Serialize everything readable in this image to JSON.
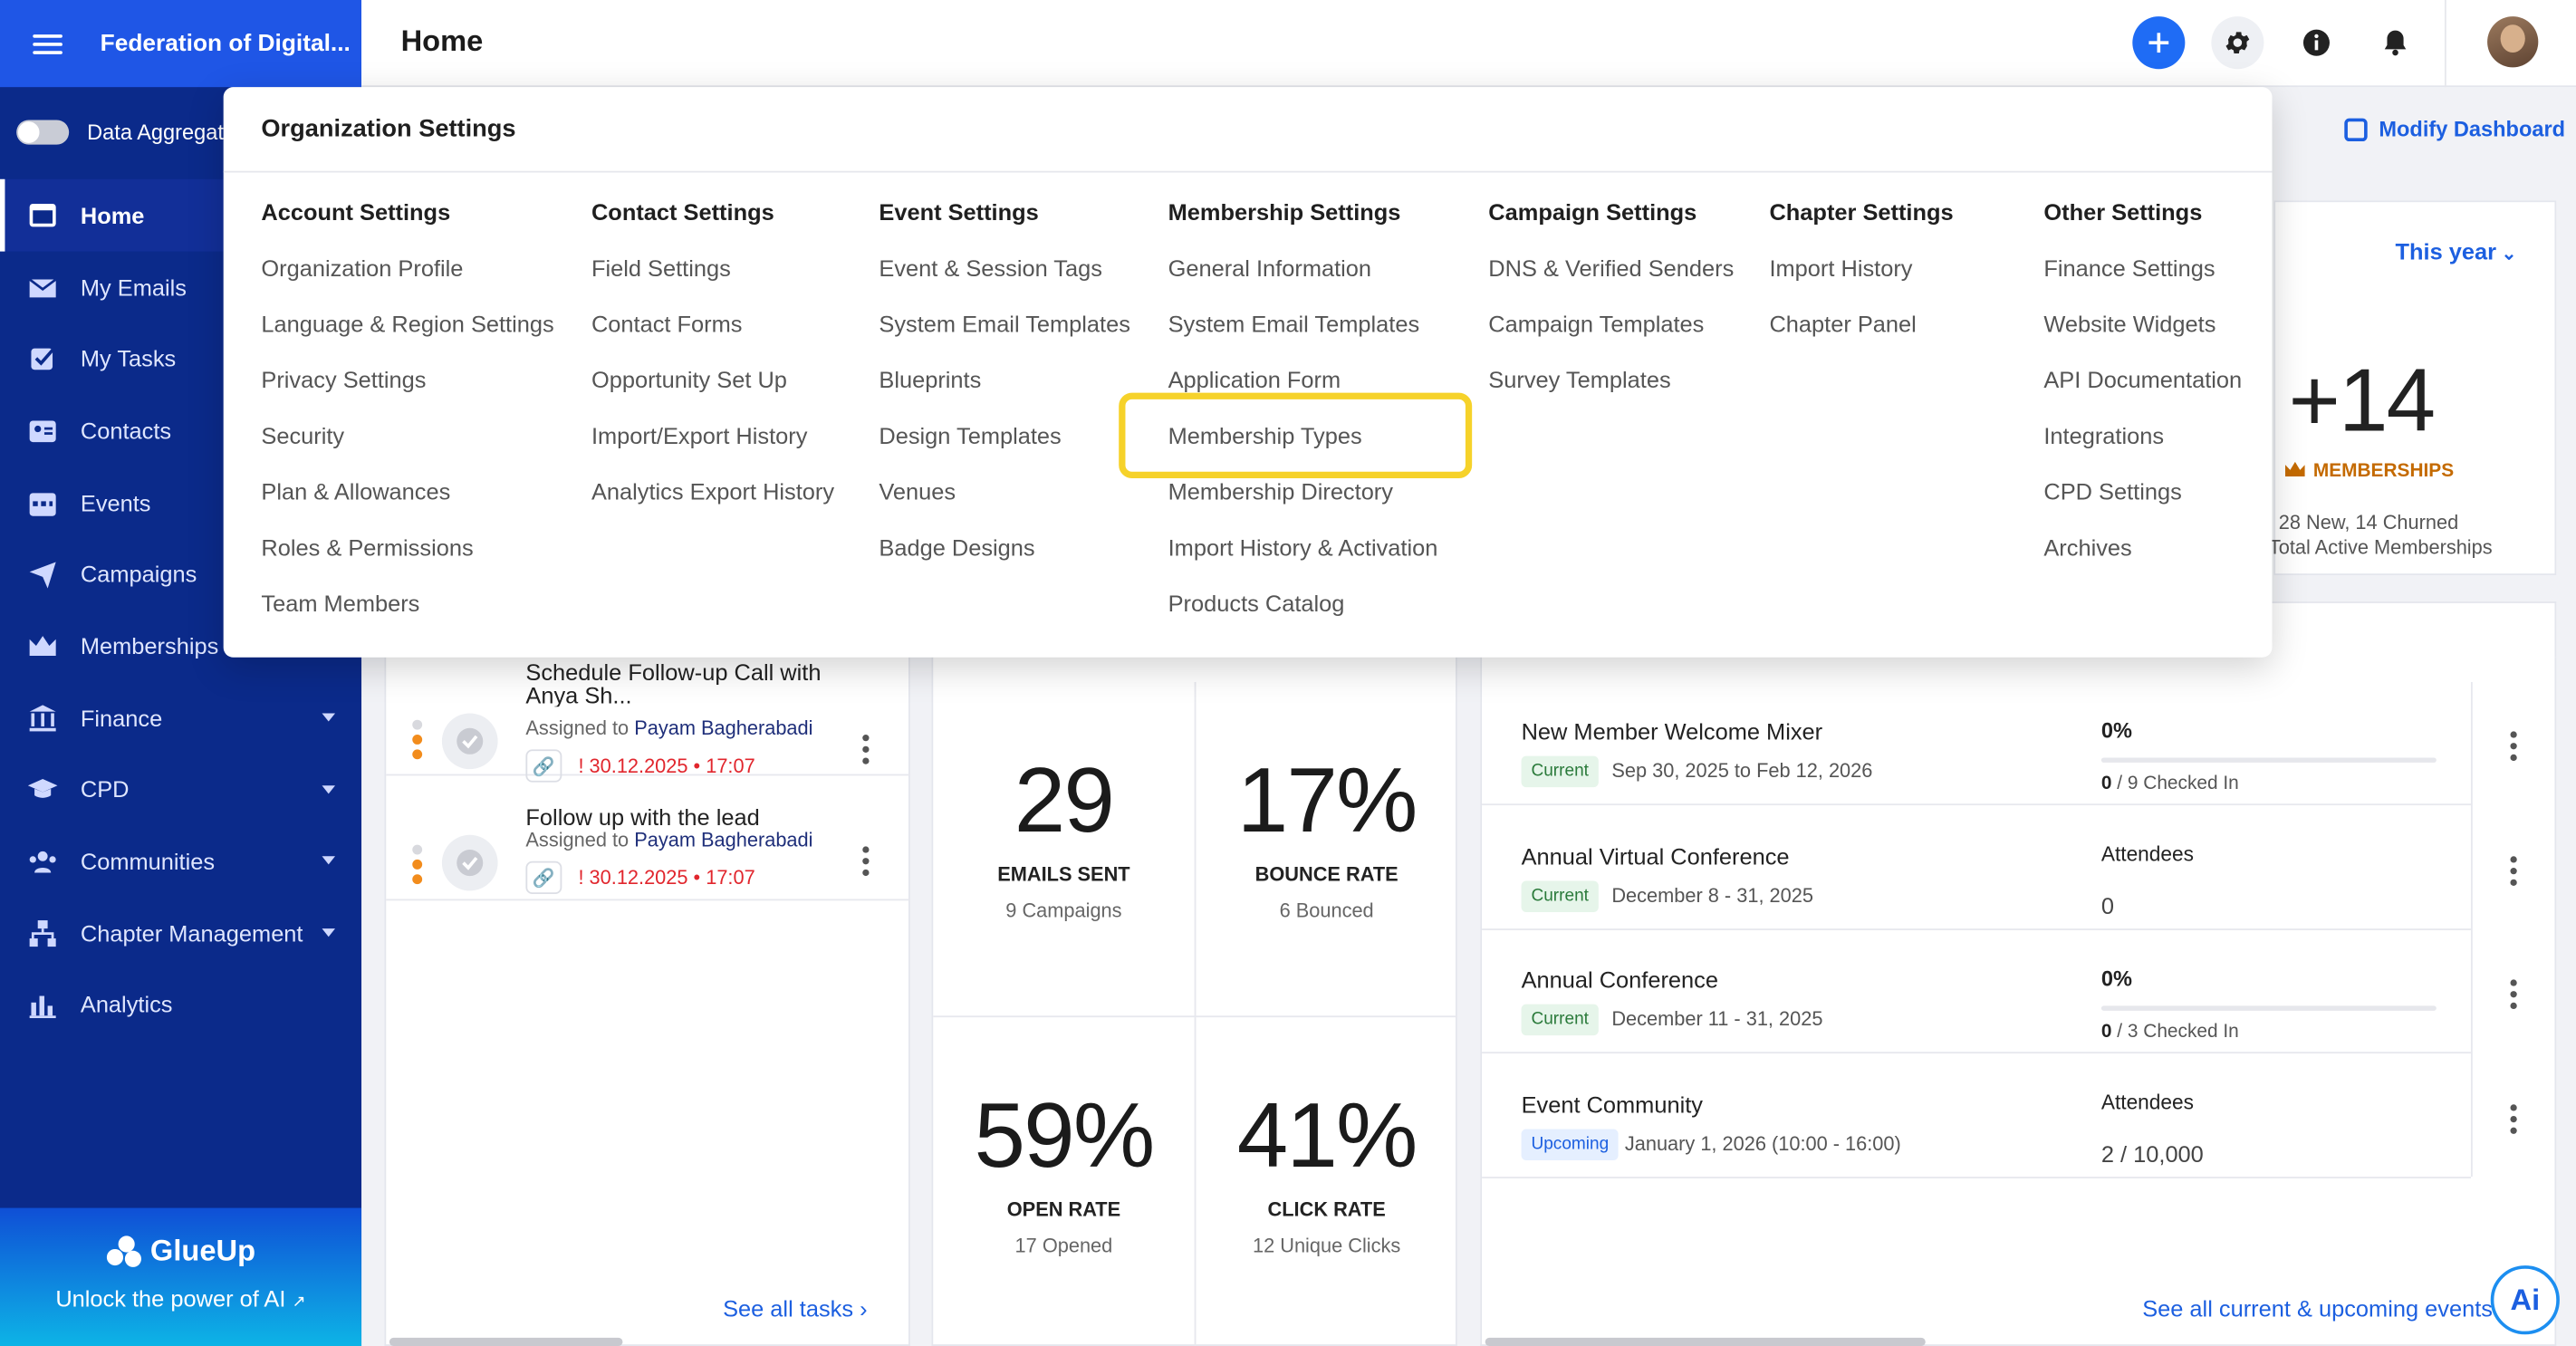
{
  "sidebar": {
    "org_name": "Federation of Digital...",
    "toggle_label": "Data Aggregat",
    "items": [
      {
        "label": "Home",
        "icon": "home-icon",
        "active": true
      },
      {
        "label": "My Emails",
        "icon": "mail-icon"
      },
      {
        "label": "My Tasks",
        "icon": "tasks-icon"
      },
      {
        "label": "Contacts",
        "icon": "contacts-icon"
      },
      {
        "label": "Events",
        "icon": "calendar-icon"
      },
      {
        "label": "Campaigns",
        "icon": "paper-plane-icon"
      },
      {
        "label": "Memberships",
        "icon": "crown-icon"
      },
      {
        "label": "Finance",
        "icon": "bank-icon",
        "caret": true
      },
      {
        "label": "CPD",
        "icon": "graduation-cap-icon",
        "caret": true
      },
      {
        "label": "Communities",
        "icon": "community-icon",
        "caret": true
      },
      {
        "label": "Chapter Management",
        "icon": "org-chart-icon",
        "caret": true
      },
      {
        "label": "Analytics",
        "icon": "bar-chart-icon"
      }
    ],
    "footer": {
      "brand": "GlueUp",
      "tagline": "Unlock the power of AI"
    }
  },
  "header": {
    "title": "Home"
  },
  "dashboard": {
    "modify_label": "Modify Dashboard",
    "memberships": {
      "period": "This year",
      "delta": "+14",
      "label": "MEMBERSHIPS",
      "new_churned": "28 New, 14 Churned",
      "total_label": "Total Active Memberships"
    },
    "tasks": {
      "items": [
        {
          "title": "Schedule Follow-up Call with Anya Sh...",
          "assigned_prefix": "Assigned to",
          "assignee": "Payam Bagherabadi",
          "due": "30.12.2025 • 17:07"
        },
        {
          "title": "Follow up with the lead",
          "assigned_prefix": "Assigned to",
          "assignee": "Payam Bagherabadi",
          "due": "30.12.2025 • 17:07"
        }
      ],
      "see_all": "See all tasks"
    },
    "stats": [
      {
        "value": "29",
        "label": "EMAILS SENT",
        "sub": "9 Campaigns"
      },
      {
        "value": "17%",
        "label": "BOUNCE RATE",
        "sub": "6 Bounced"
      },
      {
        "value": "59%",
        "label": "OPEN RATE",
        "sub": "17 Opened"
      },
      {
        "value": "41%",
        "label": "CLICK RATE",
        "sub": "12 Unique Clicks"
      }
    ],
    "events": {
      "items": [
        {
          "title": "New Member Welcome Mixer",
          "status": "Current",
          "date": "Sep 30, 2025 to Feb 12, 2026",
          "stat": "0%",
          "progress": 0,
          "checked": "0",
          "checked_rest": "/ 9 Checked In"
        },
        {
          "title": "Annual Virtual Conference",
          "status": "Current",
          "date": "December 8 - 31, 2025",
          "stat_label": "Attendees",
          "stat_value": "0"
        },
        {
          "title": "Annual Conference",
          "status": "Current",
          "date": "December 11 - 31, 2025",
          "stat": "0%",
          "progress": 0,
          "checked": "0",
          "checked_rest": "/ 3 Checked In"
        },
        {
          "title": "Event Community",
          "status": "Upcoming",
          "date": "January 1, 2026 (10:00 - 16:00)",
          "stat_label": "Attendees",
          "stat_value": "2 / 10,000"
        }
      ],
      "see_all": "See all current & upcoming events"
    },
    "ai_button": "Ai"
  },
  "settings_menu": {
    "title": "Organization Settings",
    "columns": [
      {
        "title": "Account Settings",
        "items": [
          "Organization Profile",
          "Language & Region Settings",
          "Privacy Settings",
          "Security",
          "Plan & Allowances",
          "Roles & Permissions",
          "Team Members"
        ]
      },
      {
        "title": "Contact Settings",
        "items": [
          "Field Settings",
          "Contact Forms",
          "Opportunity Set Up",
          "Import/Export History",
          "Analytics Export History"
        ]
      },
      {
        "title": "Event Settings",
        "items": [
          "Event & Session Tags",
          "System Email Templates",
          "Blueprints",
          "Design Templates",
          "Venues",
          "Badge Designs"
        ]
      },
      {
        "title": "Membership Settings",
        "items": [
          "General Information",
          "System Email Templates",
          "Application Form",
          "Membership Types",
          "Membership Directory",
          "Import History & Activation",
          "Products Catalog"
        ]
      },
      {
        "title": "Campaign Settings",
        "items": [
          "DNS & Verified Senders",
          "Campaign Templates",
          "Survey Templates"
        ]
      },
      {
        "title": "Chapter Settings",
        "items": [
          "Import History",
          "Chapter Panel"
        ]
      },
      {
        "title": "Other Settings",
        "items": [
          "Finance Settings",
          "Website Widgets",
          "API Documentation",
          "Integrations",
          "CPD Settings",
          "Archives"
        ]
      }
    ],
    "highlighted_item": "Membership Types"
  },
  "colors": {
    "sidebar": "#0b2a8a",
    "brand_bar": "#1f56e6",
    "accent": "#1c5fe0",
    "highlight": "#f6d22a",
    "due_red": "#e1262d",
    "membership_orange": "#c46a00"
  }
}
